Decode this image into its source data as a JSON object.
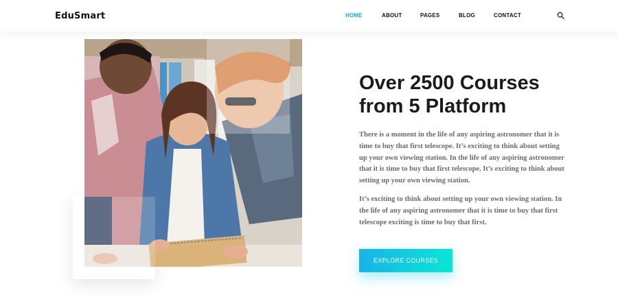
{
  "brand": {
    "logo_text": "EduSmart"
  },
  "nav": {
    "items": [
      {
        "label": "HOME",
        "active": true
      },
      {
        "label": "ABOUT",
        "active": false
      },
      {
        "label": "PAGES",
        "active": false
      },
      {
        "label": "BLOG",
        "active": false
      },
      {
        "label": "CONTACT",
        "active": false
      }
    ],
    "search_icon": "search-icon",
    "active_color": "#14a9d8"
  },
  "hero": {
    "headline": "Over 2500 Courses from 5 Platform",
    "paragraph_1": "There is a moment in the life of any aspiring astronomer that it is time to buy that first telescope. It’s exciting to think about setting up your own viewing station. In the life of any aspiring astronomer that it is time to buy that first telescope. It’s exciting to think about setting up your own viewing station.",
    "paragraph_2": "It’s exciting to think about setting up your own viewing station. In the life of any aspiring astronomer that it is time to buy that first telescope exciting is time to buy that first.",
    "cta_label": "EXPLORE COURSES",
    "cta_gradient": [
      "#18b4e6",
      "#08e6d6"
    ]
  }
}
